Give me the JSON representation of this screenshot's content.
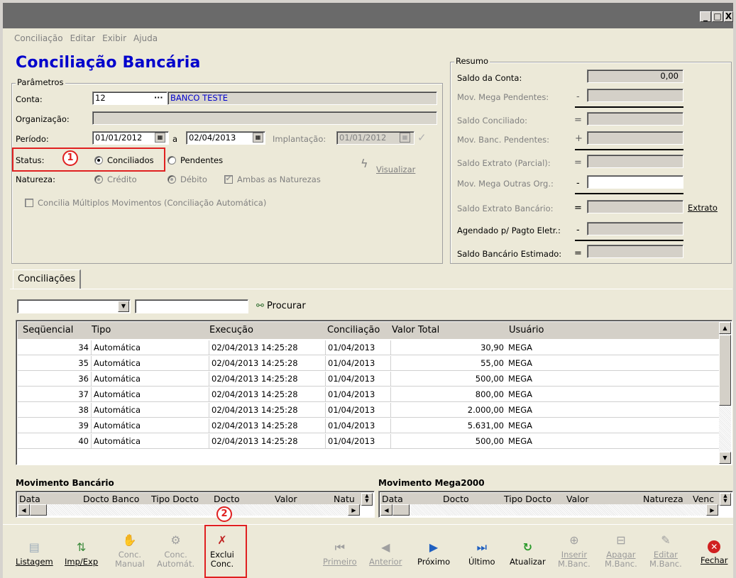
{
  "menu": [
    "Conciliação",
    "Editar",
    "Exibir",
    "Ajuda"
  ],
  "window_buttons": {
    "minimize": "_",
    "maximize": "□",
    "close": "X"
  },
  "page_title": "Conciliação Bancária",
  "parametros": {
    "group_title": "Parâmetros",
    "conta_label": "Conta:",
    "conta_value": "12",
    "conta_name": "BANCO TESTE",
    "organizacao_label": "Organização:",
    "periodo_label": "Período:",
    "periodo_start": "01/01/2012",
    "periodo_sep": "a",
    "periodo_end": "02/04/2013",
    "implantacao_label": "Implantação:",
    "implantacao_value": "01/01/2012",
    "status_label": "Status:",
    "status_conciliados": "Conciliados",
    "status_pendentes": "Pendentes",
    "natureza_label": "Natureza:",
    "natureza_credito": "Crédito",
    "natureza_debito": "Débito",
    "natureza_ambas": "Ambas as Naturezas",
    "visualizar": "Visualizar",
    "concilia_multiplos": "Concilia Múltiplos Movimentos (Conciliação Automática)"
  },
  "resumo": {
    "group_title": "Resumo",
    "rows": [
      {
        "label": "Saldo da Conta:",
        "op": "",
        "value": "0,00"
      },
      {
        "label": "Mov. Mega Pendentes:",
        "op": "-",
        "value": ""
      },
      {
        "label": "Saldo Conciliado:",
        "op": "=",
        "value": ""
      },
      {
        "label": "Mov. Banc. Pendentes:",
        "op": "+",
        "value": ""
      },
      {
        "label": "Saldo Extrato (Parcial):",
        "op": "=",
        "value": ""
      },
      {
        "label": "Mov. Mega Outras Org.:",
        "op": "-",
        "value": ""
      },
      {
        "label": "Saldo Extrato Bancário:",
        "op": "=",
        "value": ""
      },
      {
        "label": "Agendado p/ Pagto Eletr.:",
        "op": "-",
        "value": ""
      },
      {
        "label": "Saldo Bancário Estimado:",
        "op": "=",
        "value": ""
      }
    ],
    "extrato_button": "Extrato"
  },
  "tab_label": "Conciliações",
  "procurar": "Procurar",
  "grid": {
    "headers": [
      "Seqüencial",
      "Tipo",
      "Execução",
      "Conciliação",
      "Valor Total",
      "Usuário"
    ],
    "rows": [
      {
        "seq": "34",
        "tipo": "Automática",
        "exec": "02/04/2013 14:25:28",
        "conc": "01/04/2013",
        "valor": "30,90",
        "usuario": "MEGA"
      },
      {
        "seq": "35",
        "tipo": "Automática",
        "exec": "02/04/2013 14:25:28",
        "conc": "01/04/2013",
        "valor": "55,00",
        "usuario": "MEGA"
      },
      {
        "seq": "36",
        "tipo": "Automática",
        "exec": "02/04/2013 14:25:28",
        "conc": "01/04/2013",
        "valor": "500,00",
        "usuario": "MEGA"
      },
      {
        "seq": "37",
        "tipo": "Automática",
        "exec": "02/04/2013 14:25:28",
        "conc": "01/04/2013",
        "valor": "800,00",
        "usuario": "MEGA"
      },
      {
        "seq": "38",
        "tipo": "Automática",
        "exec": "02/04/2013 14:25:28",
        "conc": "01/04/2013",
        "valor": "2.000,00",
        "usuario": "MEGA"
      },
      {
        "seq": "39",
        "tipo": "Automática",
        "exec": "02/04/2013 14:25:28",
        "conc": "01/04/2013",
        "valor": "5.631,00",
        "usuario": "MEGA"
      },
      {
        "seq": "40",
        "tipo": "Automática",
        "exec": "02/04/2013 14:25:28",
        "conc": "01/04/2013",
        "valor": "500,00",
        "usuario": "MEGA"
      }
    ]
  },
  "mov_bancario": {
    "title": "Movimento Bancário",
    "headers": [
      "Data",
      "Docto Banco",
      "Tipo Docto",
      "Docto",
      "Valor",
      "Natu"
    ]
  },
  "mov_mega": {
    "title": "Movimento Mega2000",
    "headers": [
      "Data",
      "Docto",
      "Tipo Docto",
      "Valor",
      "Natureza",
      "Venc"
    ]
  },
  "annotations": {
    "badge1": "1",
    "badge2": "2"
  },
  "toolbar": {
    "listagem": "Listagem",
    "impexp": "Imp/Exp",
    "conc_manual_1": "Conc.",
    "conc_manual_2": "Manual",
    "conc_auto_1": "Conc.",
    "conc_auto_2": "Automát.",
    "exclui_1": "Exclui",
    "exclui_2": "Conc.",
    "primeiro": "Primeiro",
    "anterior": "Anterior",
    "proximo": "Próximo",
    "ultimo": "Último",
    "atualizar": "Atualizar",
    "inserir_1": "Inserir",
    "inserir_2": "M.Banc.",
    "apagar_1": "Apagar",
    "apagar_2": "M.Banc.",
    "editar_1": "Editar",
    "editar_2": "M.Banc.",
    "fechar": "Fechar"
  }
}
